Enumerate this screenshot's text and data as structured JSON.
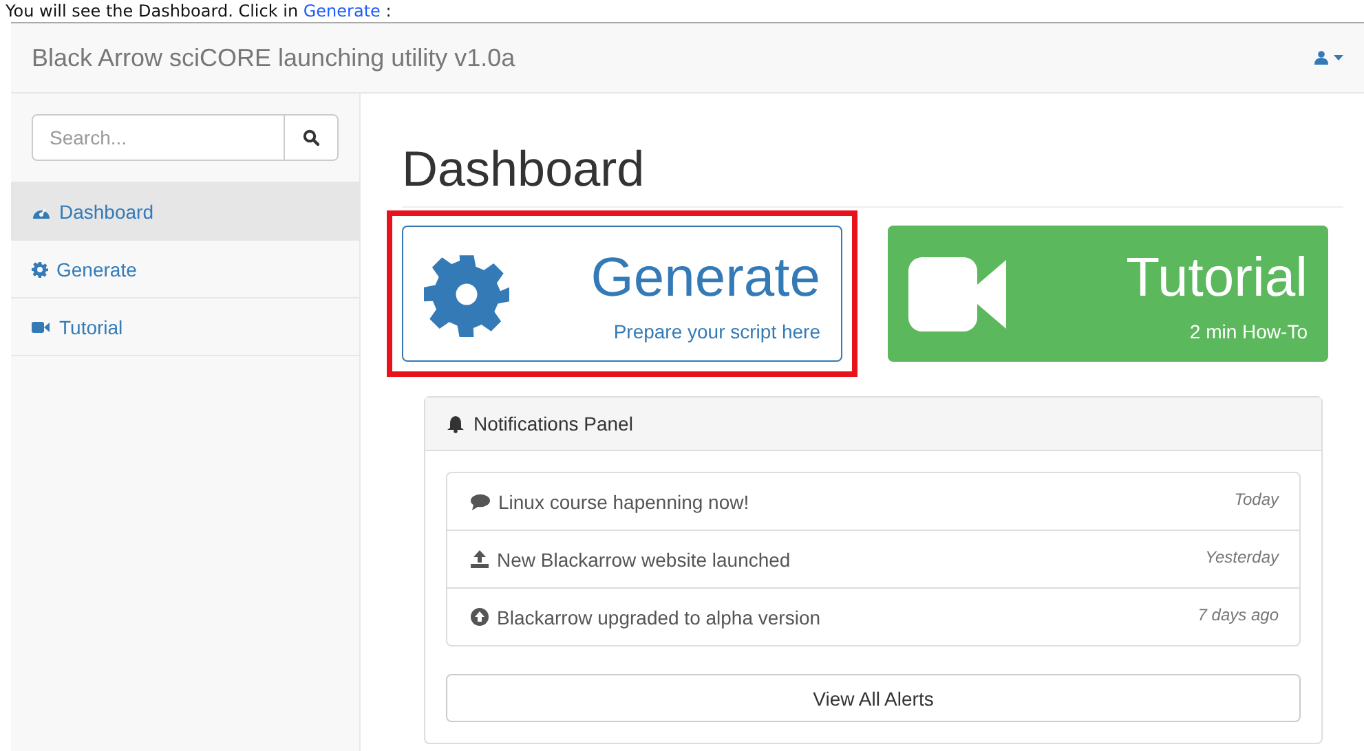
{
  "caption": {
    "text": "You will see the Dashboard. Click in ",
    "link": "Generate",
    "suffix": " :"
  },
  "navbar": {
    "brand": "Black Arrow sciCORE launching utility v1.0a"
  },
  "sidebar": {
    "search": {
      "placeholder": "Search..."
    },
    "items": [
      {
        "label": "Dashboard",
        "selected": true
      },
      {
        "label": "Generate",
        "selected": false
      },
      {
        "label": "Tutorial",
        "selected": false
      }
    ]
  },
  "page_title": "Dashboard",
  "tiles": [
    {
      "title": "Generate",
      "subtitle": "Prepare your script here",
      "kind": "outline",
      "highlighted": true
    },
    {
      "title": "Tutorial",
      "subtitle": "2 min How-To",
      "kind": "solid",
      "highlighted": false
    }
  ],
  "notifications": {
    "title": "Notifications Panel",
    "items": [
      {
        "text": "Linux course hapenning now!",
        "time": "Today"
      },
      {
        "text": "New Blackarrow website launched",
        "time": "Yesterday"
      },
      {
        "text": "Blackarrow upgraded to alpha version",
        "time": "7 days ago"
      }
    ],
    "button": "View All Alerts"
  }
}
